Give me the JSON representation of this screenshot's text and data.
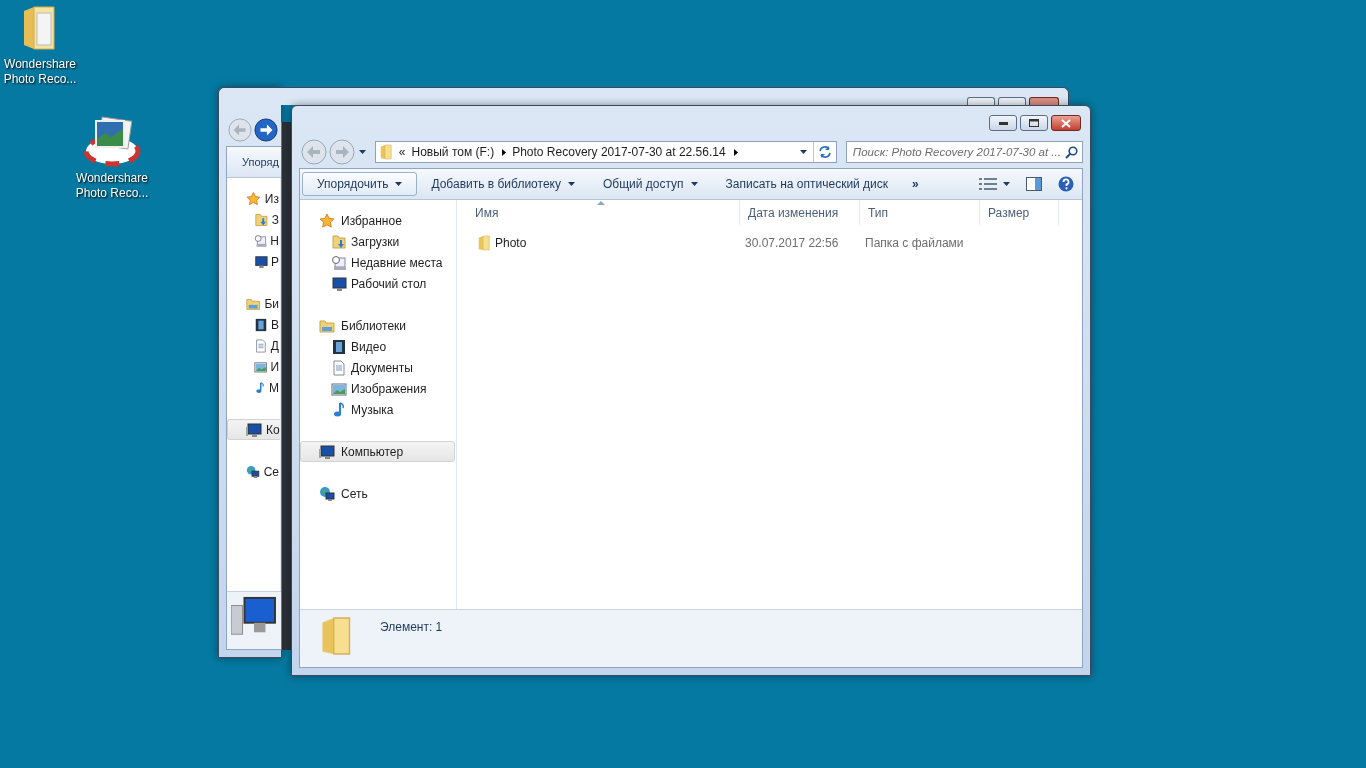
{
  "desktop_icons": [
    {
      "label": "Wondershare Photo Reco...",
      "kind": "folder"
    },
    {
      "label": "Wondershare Photo Reco...",
      "kind": "app"
    }
  ],
  "back_window": {
    "toolbar": [
      {
        "label": "Упоряд"
      }
    ],
    "sidebar": [
      {
        "label": "Из",
        "kind": "star",
        "selected": false,
        "children": [
          {
            "label": "З",
            "kind": "downloads",
            "selected": false
          },
          {
            "label": "Н",
            "kind": "recent",
            "selected": false
          },
          {
            "label": "Р",
            "kind": "desktop",
            "selected": false
          }
        ]
      },
      {
        "label": "Би",
        "kind": "library",
        "selected": false,
        "children": [
          {
            "label": "В",
            "kind": "video",
            "selected": false
          },
          {
            "label": "Д",
            "kind": "documents",
            "selected": false
          },
          {
            "label": "И",
            "kind": "images",
            "selected": false
          },
          {
            "label": "М",
            "kind": "music",
            "selected": false
          }
        ]
      },
      {
        "label": "Ко",
        "kind": "computer",
        "selected": true
      },
      {
        "label": "Се",
        "kind": "network",
        "selected": false
      }
    ]
  },
  "front_window": {
    "address": {
      "overflow_mark": "«",
      "crumbs": [
        "Новый том (F:)",
        "Photo Recovery 2017-07-30 at 22.56.14"
      ]
    },
    "search": {
      "placeholder": "Поиск: Photo Recovery 2017-07-30 at ..."
    },
    "toolbar": [
      {
        "label": "Упорядочить",
        "kind": "menu",
        "highlighted": true
      },
      {
        "label": "Добавить в библиотеку",
        "kind": "menu",
        "highlighted": false
      },
      {
        "label": "Общий доступ",
        "kind": "menu",
        "highlighted": false
      },
      {
        "label": "Записать на оптический диск",
        "kind": "command",
        "highlighted": false
      }
    ],
    "more": "»",
    "sidebar": [
      {
        "label": "Избранное",
        "kind": "star",
        "selected": false,
        "children": [
          {
            "label": "Загрузки",
            "kind": "downloads",
            "selected": false
          },
          {
            "label": "Недавние места",
            "kind": "recent",
            "selected": false
          },
          {
            "label": "Рабочий стол",
            "kind": "desktop",
            "selected": false
          }
        ]
      },
      {
        "label": "Библиотеки",
        "kind": "library",
        "selected": false,
        "children": [
          {
            "label": "Видео",
            "kind": "video",
            "selected": false
          },
          {
            "label": "Документы",
            "kind": "documents",
            "selected": false
          },
          {
            "label": "Изображения",
            "kind": "images",
            "selected": false
          },
          {
            "label": "Музыка",
            "kind": "music",
            "selected": false
          }
        ]
      },
      {
        "label": "Компьютер",
        "kind": "computer",
        "selected": true
      },
      {
        "label": "Сеть",
        "kind": "network",
        "selected": false
      }
    ],
    "columns": [
      "Имя",
      "Дата изменения",
      "Тип",
      "Размер"
    ],
    "rows": [
      {
        "name": "Photo",
        "date": "30.07.2017 22:56",
        "type": "Папка с файлами"
      }
    ],
    "status": "Элемент: 1"
  }
}
